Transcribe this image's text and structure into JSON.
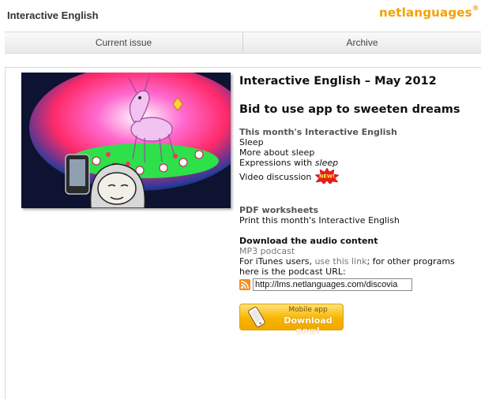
{
  "header": {
    "title": "Interactive English",
    "brand": "netlanguages",
    "brand_mark": "®"
  },
  "tabs": [
    {
      "label": "Current issue"
    },
    {
      "label": "Archive"
    }
  ],
  "issue": {
    "title": "Interactive English – May 2012",
    "headline": "Bid to use app to sweeten dreams"
  },
  "this_month": {
    "heading": "This month's Interactive English",
    "items": [
      "Sleep",
      "More about sleep"
    ],
    "expressions_prefix": "Expressions with ",
    "expressions_word": "sleep",
    "video": "Video discussion",
    "badge": "NEW!"
  },
  "pdf": {
    "heading": "PDF worksheets",
    "link": "Print this month's Interactive English"
  },
  "audio": {
    "heading": "Download the audio content",
    "subheading": "MP3 podcast",
    "text_before": "For iTunes users, ",
    "link": "use this link",
    "text_after": "; for other programs here is the podcast URL:",
    "url": "http://lms.netlanguages.com/discovia"
  },
  "app_button": {
    "top_label": "Mobile app",
    "main_label": "Download now!"
  },
  "colors": {
    "brand": "#f2a100",
    "button": "#f7b500"
  },
  "icons": [
    "rss-icon",
    "phone-icon",
    "new-badge-icon"
  ]
}
